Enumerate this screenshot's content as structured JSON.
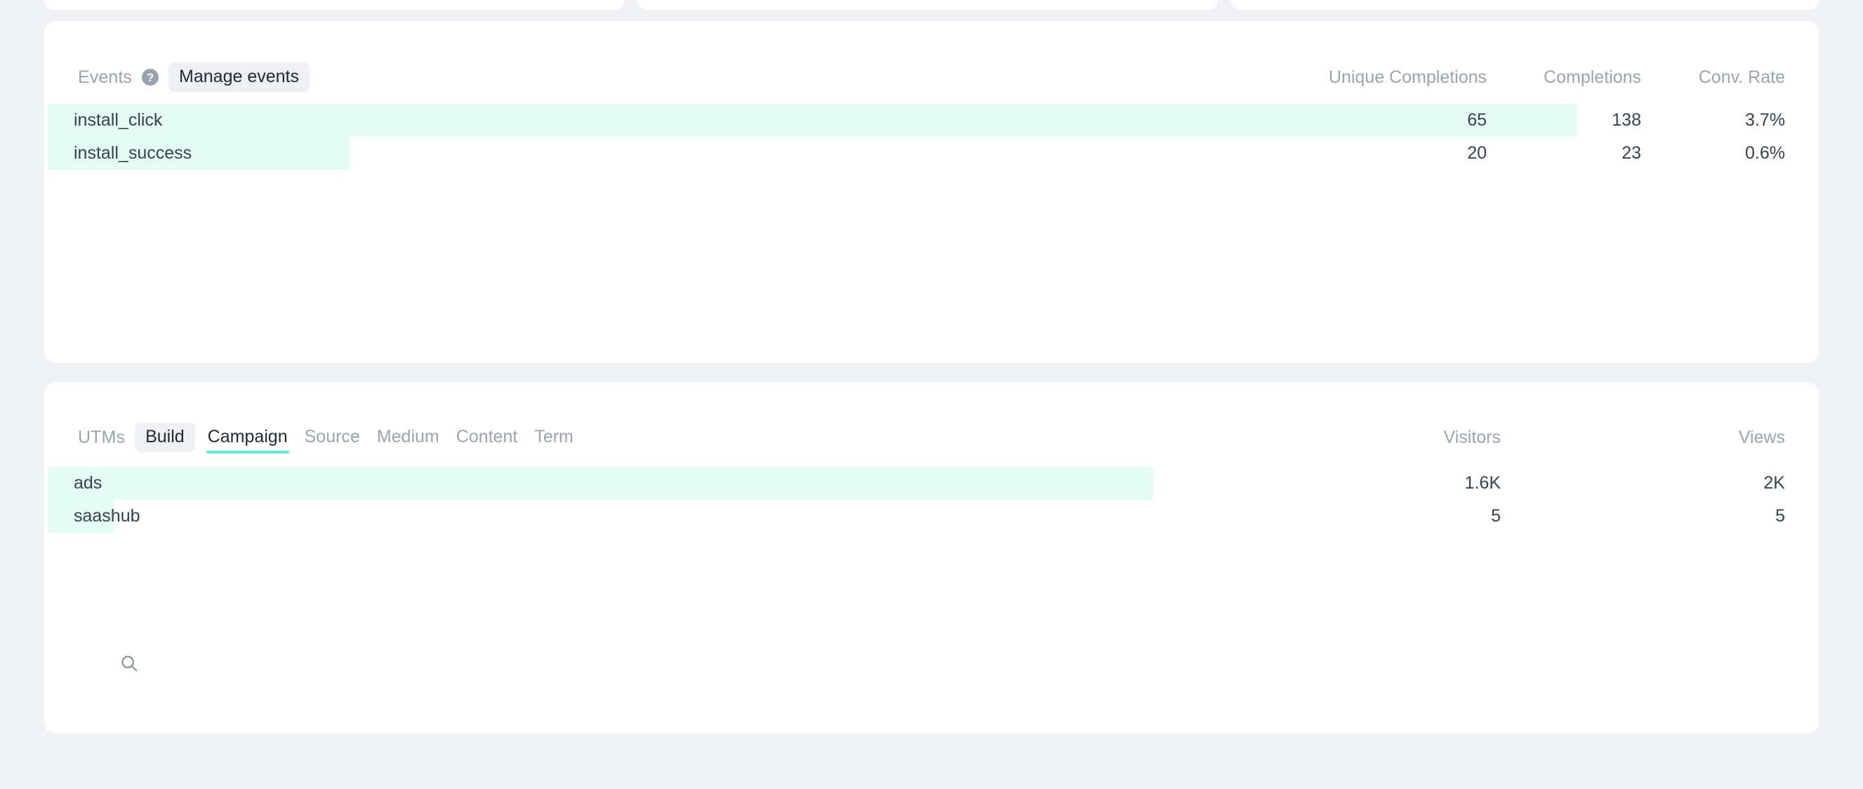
{
  "page": {
    "background_color": "#f1f2f6",
    "card_color": "#ffffff",
    "bar_color": "#e5fcf4",
    "accent_color": "#5eead4",
    "muted_text_color": "#9ca3af",
    "text_color": "#374151"
  },
  "events_panel": {
    "label": "Events",
    "help_icon": "question-mark-circle-icon",
    "manage_button": "Manage events",
    "columns": [
      "Unique Completions",
      "Completions",
      "Conv. Rate"
    ],
    "rows": [
      {
        "name": "install_click",
        "unique_completions": "65",
        "completions": "138",
        "conv_rate": "3.7%",
        "bar_pct": 86.2
      },
      {
        "name": "install_success",
        "unique_completions": "20",
        "completions": "23",
        "conv_rate": "0.6%",
        "bar_pct": 17.0
      }
    ]
  },
  "utms_panel": {
    "label": "UTMs",
    "build_button": "Build",
    "tabs": [
      {
        "label": "Campaign",
        "active": true
      },
      {
        "label": "Source",
        "active": false
      },
      {
        "label": "Medium",
        "active": false
      },
      {
        "label": "Content",
        "active": false
      },
      {
        "label": "Term",
        "active": false
      }
    ],
    "columns": [
      "Visitors",
      "Views"
    ],
    "rows": [
      {
        "name": "ads",
        "visitors": "1.6K",
        "views": "2K",
        "bar_pct": 62.3
      },
      {
        "name": "saashub",
        "visitors": "5",
        "views": "5",
        "bar_pct": 3.7
      }
    ],
    "search_icon": "search-icon"
  },
  "chart_data": {
    "type": "bar",
    "title": "Events and UTM Campaign breakdown",
    "charts": [
      {
        "name": "Events",
        "type": "bar",
        "orientation": "horizontal",
        "categories": [
          "install_click",
          "install_success"
        ],
        "series": [
          {
            "name": "Unique Completions",
            "values": [
              65,
              20
            ]
          },
          {
            "name": "Completions",
            "values": [
              138,
              23
            ]
          },
          {
            "name": "Conv. Rate",
            "values": [
              3.7,
              0.6
            ]
          }
        ],
        "bar_lengths_pct": [
          86.2,
          17.0
        ],
        "grid": false
      },
      {
        "name": "UTMs - Campaign",
        "type": "bar",
        "orientation": "horizontal",
        "categories": [
          "ads",
          "saashub"
        ],
        "series": [
          {
            "name": "Visitors",
            "values": [
              1600,
              5
            ]
          },
          {
            "name": "Views",
            "values": [
              2000,
              5
            ]
          }
        ],
        "bar_lengths_pct": [
          62.3,
          3.7
        ],
        "grid": false
      }
    ]
  }
}
